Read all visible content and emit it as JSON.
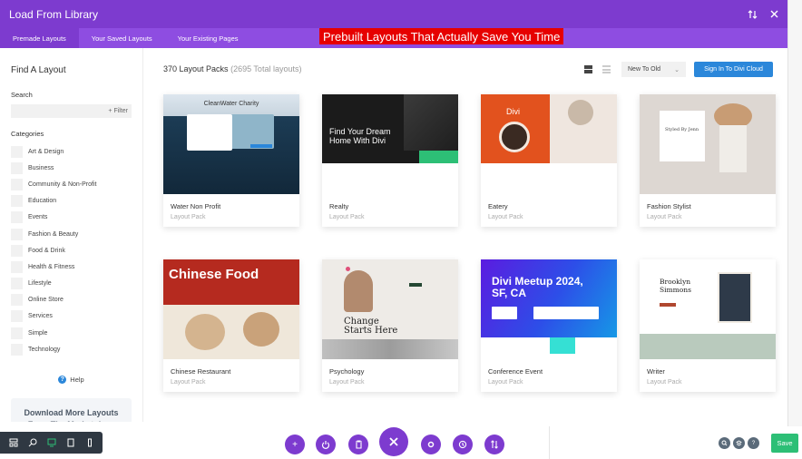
{
  "header": {
    "title": "Load From Library",
    "sort_icon": "sort-arrows-icon",
    "close_icon": "close-icon"
  },
  "tabs": [
    {
      "label": "Premade Layouts",
      "active": true
    },
    {
      "label": "Your Saved Layouts",
      "active": false
    },
    {
      "label": "Your Existing Pages",
      "active": false
    }
  ],
  "promo_banner": "Prebuilt Layouts That Actually Save You Time",
  "sidebar": {
    "title": "Find A Layout",
    "search_label": "Search",
    "filter_label": "+ Filter",
    "categories_label": "Categories",
    "categories": [
      "Art & Design",
      "Business",
      "Community & Non-Profit",
      "Education",
      "Events",
      "Fashion & Beauty",
      "Food & Drink",
      "Health & Fitness",
      "Lifestyle",
      "Online Store",
      "Services",
      "Simple",
      "Technology"
    ],
    "help_label": "Help",
    "download_text": "Download More Layouts From The Marketplace"
  },
  "main": {
    "count_label": "370 Layout Packs",
    "total_label": "(2695 Total layouts)",
    "sort_value": "New To Old",
    "cloud_button": "Sign In To Divi Cloud"
  },
  "cards": [
    {
      "name": "Water Non Profit",
      "type": "Layout Pack",
      "thumb_text": "CleanWater Charity"
    },
    {
      "name": "Realty",
      "type": "Layout Pack",
      "thumb_text": "Find Your Dream Home With Divi"
    },
    {
      "name": "Eatery",
      "type": "Layout Pack",
      "thumb_text": "Divi"
    },
    {
      "name": "Fashion Stylist",
      "type": "Layout Pack",
      "thumb_text": "Styled By Jenn"
    },
    {
      "name": "Chinese Restaurant",
      "type": "Layout Pack",
      "thumb_text": "Chinese Food"
    },
    {
      "name": "Psychology",
      "type": "Layout Pack",
      "thumb_text": "Change Starts Here"
    },
    {
      "name": "Conference Event",
      "type": "Layout Pack",
      "thumb_text": "Divi Meetup 2024, SF, CA"
    },
    {
      "name": "Writer",
      "type": "Layout Pack",
      "thumb_text": "Brooklyn Simmons"
    }
  ],
  "bottom": {
    "save_label": "Save"
  },
  "colors": {
    "header": "#7d3bcf",
    "tabbar": "#8e4de1",
    "accent_blue": "#2b87da",
    "save_green": "#2dbf76"
  }
}
